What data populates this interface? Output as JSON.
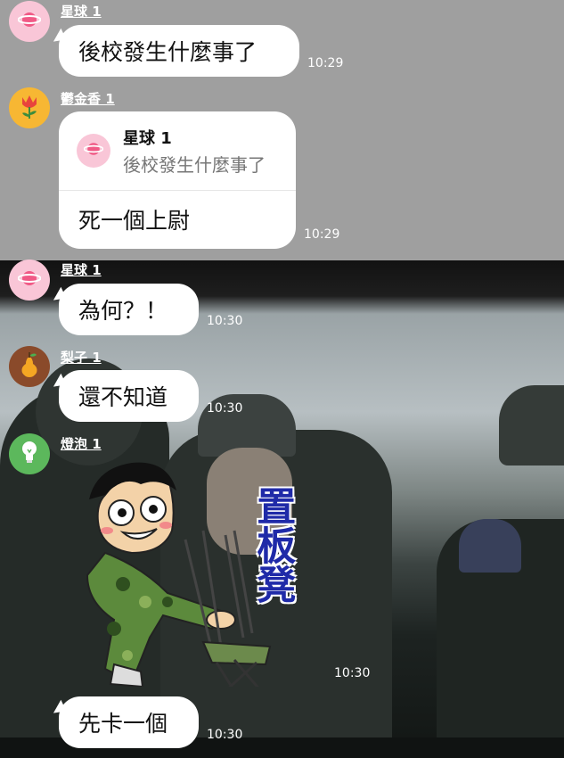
{
  "colors": {
    "bubble": "#ffffff",
    "time": "#ffffff",
    "sticker_text": "#1f2aa8"
  },
  "messages": [
    {
      "sender": "星球 1",
      "avatar_icon": "planet-icon",
      "text": "後校發生什麼事了",
      "time": "10:29"
    },
    {
      "sender": "鬱金香 1",
      "avatar_icon": "tulip-icon",
      "reply_to": {
        "sender": "星球 1",
        "text": "後校發生什麼事了"
      },
      "text": "死一個上尉",
      "time": "10:29"
    },
    {
      "sender": "星球 1",
      "avatar_icon": "planet-icon",
      "text": "為何？！",
      "time": "10:30"
    },
    {
      "sender": "梨子 1",
      "avatar_icon": "pear-icon",
      "text": "還不知道",
      "time": "10:30"
    },
    {
      "sender": "燈泡 1",
      "avatar_icon": "lightbulb-icon",
      "sticker": {
        "caption": "置板凳",
        "icon": "soldier-carrying-stool-sticker"
      },
      "time": "10:30"
    },
    {
      "text": "先卡一個",
      "time": "10:30"
    }
  ]
}
